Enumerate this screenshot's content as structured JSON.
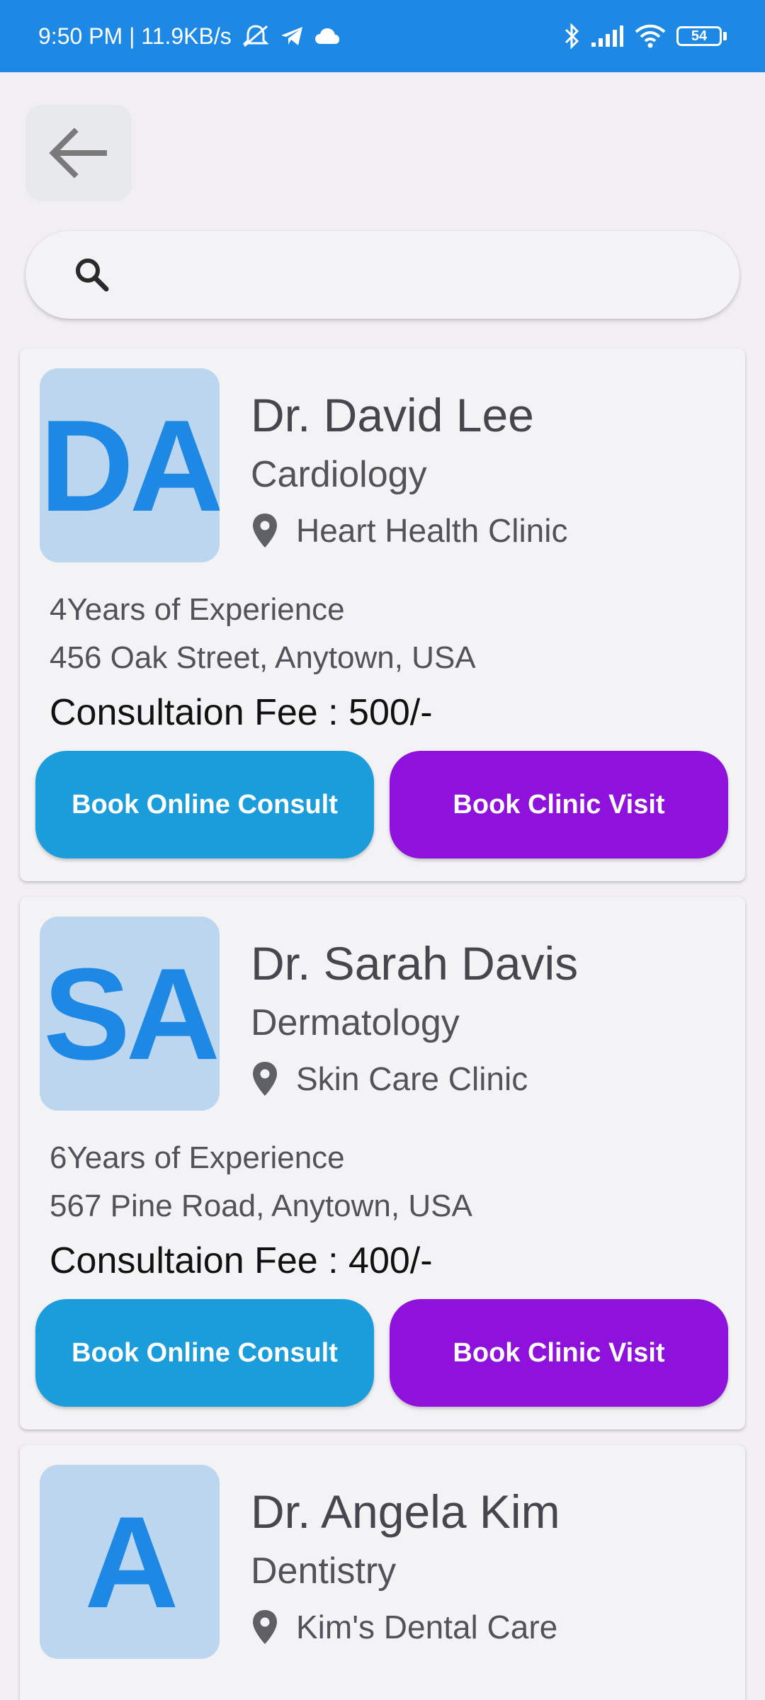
{
  "status_bar": {
    "time_info": "9:50 PM | 11.9KB/s",
    "battery": "54",
    "icons": [
      "mute-icon",
      "telegram-icon",
      "cloud-icon",
      "bluetooth-icon",
      "signal-icon",
      "wifi-icon",
      "battery-icon"
    ]
  },
  "search": {
    "placeholder": "",
    "value": ""
  },
  "colors": {
    "status_bar": "#1e88e5",
    "avatar_bg": "#bcd6f0",
    "avatar_text": "#1e88e5",
    "online_button": "#1c9ddb",
    "clinic_button": "#8e12dc"
  },
  "doctors": [
    {
      "initials": "DA",
      "name": "Dr. David Lee",
      "specialty": "Cardiology",
      "clinic": "Heart Health Clinic",
      "experience": "4Years of Experience",
      "address": "456 Oak Street, Anytown, USA",
      "fee": "Consultaion Fee : 500/-",
      "online_label": "Book Online Consult",
      "clinic_label": "Book Clinic Visit"
    },
    {
      "initials": "SA",
      "name": "Dr. Sarah Davis",
      "specialty": "Dermatology",
      "clinic": "Skin Care Clinic",
      "experience": "6Years of Experience",
      "address": "567 Pine Road, Anytown, USA",
      "fee": "Consultaion Fee : 400/-",
      "online_label": "Book Online Consult",
      "clinic_label": "Book Clinic Visit"
    },
    {
      "initials": "A",
      "name": "Dr. Angela Kim",
      "specialty": "Dentistry",
      "clinic": "Kim's Dental Care"
    }
  ]
}
